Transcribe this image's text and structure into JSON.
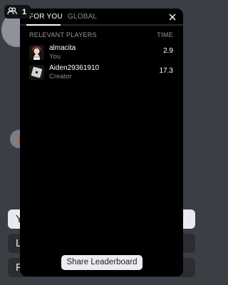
{
  "players_badge": {
    "icon": "people-icon",
    "count": "1"
  },
  "leaderboard": {
    "tabs": [
      {
        "label": "FOR YOU",
        "active": true
      },
      {
        "label": "GLOBAL",
        "active": false
      }
    ],
    "close_icon": "close-icon",
    "columns": {
      "left": "RELEVANT PLAYERS",
      "right": "TIME"
    },
    "rows": [
      {
        "name": "almacita",
        "subtitle": "You",
        "time": "2.9",
        "avatar": "avatar-character"
      },
      {
        "name": "Aiden29361910",
        "subtitle": "Creator",
        "time": "17.3",
        "avatar": "avatar-roblox-logo"
      }
    ],
    "share_label": "Share Leaderboard"
  },
  "background_menu": {
    "buttons": [
      "Y",
      "L",
      "P"
    ]
  },
  "colors": {
    "panel": "#000000",
    "background": "#3b3e45",
    "share_button": "#ececf1"
  }
}
